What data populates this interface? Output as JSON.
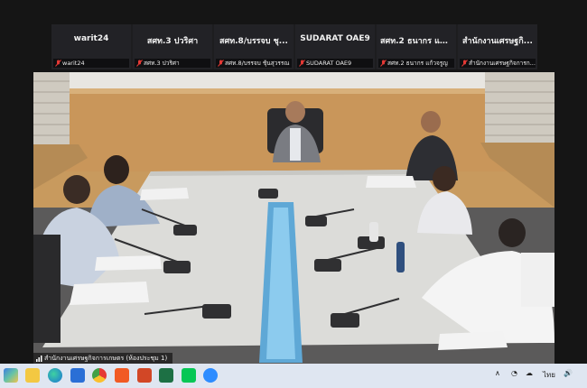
{
  "participants": [
    {
      "name": "warit24",
      "label": "warit24"
    },
    {
      "name": "สศท.3  ปวริศา",
      "label": "สศท.3  ปวริศา"
    },
    {
      "name": "สศท.8/บรรจบ ชุ...",
      "label": "สศท.8/บรรจบ ชุ้นสุวรรณ"
    },
    {
      "name": "SUDARAT OAE9",
      "label": "SUDARAT OAE9"
    },
    {
      "name": "สศท.2 ธนากร แก้...",
      "label": "สศท.2 ธนากร แก้วจรูญ"
    },
    {
      "name": "สำนักงานเศรษฐกิ...",
      "label": "สำนักงานเศรษฐกิจการก..."
    }
  ],
  "active_speaker_label": "สำนักงานเศรษฐกิจการเกษตร (ห้องประชุม 1)",
  "taskbar": {
    "icons": [
      "widgets-icon",
      "file-explorer-icon",
      "edge-icon",
      "store-icon",
      "chrome-icon",
      "brave-icon",
      "powerpoint-icon",
      "excel-icon",
      "line-icon",
      "zoom-icon"
    ],
    "tray_language": "ไทย"
  },
  "colors": {
    "muted_mic": "#e53935",
    "strip_bg": "#1d1d1f",
    "taskbar_bg": "#dfe6f1"
  }
}
